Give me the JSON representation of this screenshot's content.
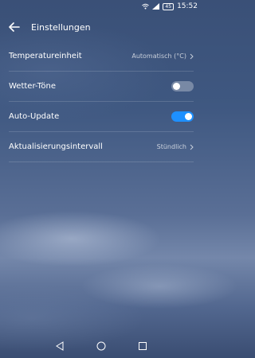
{
  "status_bar": {
    "time": "15:52",
    "battery": "45"
  },
  "header": {
    "title": "Einstellungen"
  },
  "settings": [
    {
      "label": "Temperatureinheit",
      "value": "Automatisch (°C)"
    },
    {
      "label": "Wetter-Töne",
      "toggle": "off"
    },
    {
      "label": "Auto-Update",
      "toggle": "on"
    },
    {
      "label": "Aktualisierungsintervall",
      "value": "Stündlich"
    }
  ],
  "colors": {
    "toggle_on": "#1e90ff"
  },
  "icons": [
    "wifi-icon",
    "signal-icon",
    "battery-icon",
    "back-arrow-icon",
    "chevron-right-icon",
    "nav-back-icon",
    "nav-home-icon",
    "nav-recents-icon"
  ]
}
